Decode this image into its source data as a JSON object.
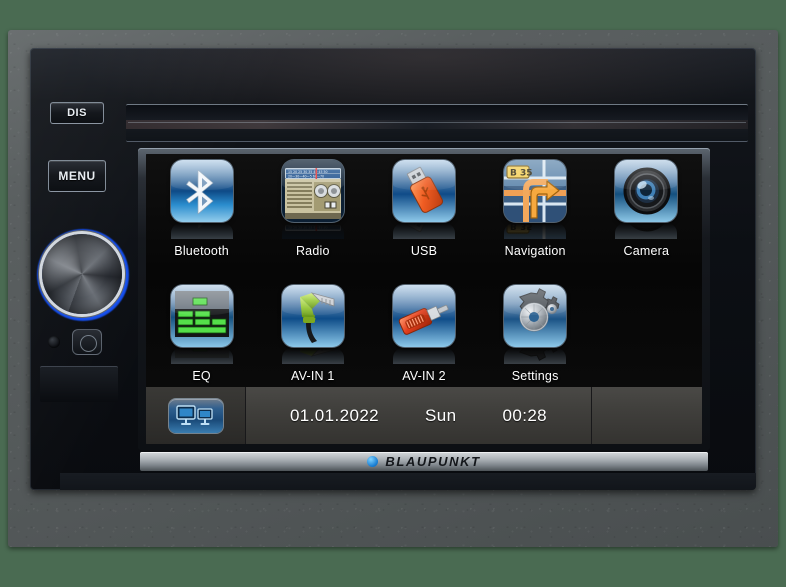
{
  "device": {
    "brand": "BLAUPUNKT",
    "brand_dot_color": "#1a7fd4",
    "frame_color": "#565b5c",
    "background_color": "#4a6b52",
    "body_color": "#0c0f14"
  },
  "hardware_buttons": [
    {
      "id": "dis",
      "label": "DIS"
    },
    {
      "id": "menu",
      "label": "MENU"
    }
  ],
  "controls": {
    "volume_knob": "volume-knob",
    "ir_sensor": "ir-sensor",
    "reset_button": "reset-button",
    "cd_slot": "cd-slot"
  },
  "screen": {
    "rows": [
      [
        {
          "label": "Bluetooth",
          "icon": "bluetooth-icon"
        },
        {
          "label": "Radio",
          "icon": "radio-icon"
        },
        {
          "label": "USB",
          "icon": "usb-icon"
        },
        {
          "label": "Navigation",
          "icon": "navigation-icon"
        },
        {
          "label": "Camera",
          "icon": "camera-icon"
        }
      ],
      [
        {
          "label": "EQ",
          "icon": "equalizer-icon"
        },
        {
          "label": "AV-IN 1",
          "icon": "av-in-1-icon"
        },
        {
          "label": "AV-IN 2",
          "icon": "av-in-2-icon"
        },
        {
          "label": "Settings",
          "icon": "settings-gears-icon"
        }
      ]
    ],
    "status_bar": {
      "display_mode_icon": "dual-screen-icon",
      "date": "01.01.2022",
      "day": "Sun",
      "time": "00:28"
    }
  },
  "navigation_icon_detail": {
    "road_sign": "B 35"
  }
}
